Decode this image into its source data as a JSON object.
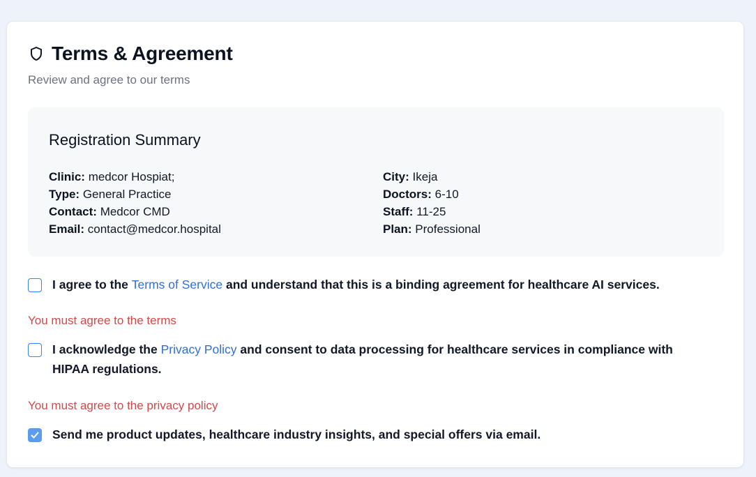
{
  "header": {
    "title": "Terms & Agreement",
    "subtitle": "Review and agree to our terms",
    "icon": "shield-icon"
  },
  "summary": {
    "title": "Registration Summary",
    "left": [
      {
        "label": "Clinic:",
        "value": "medcor Hospiat;"
      },
      {
        "label": "Type:",
        "value": "General Practice"
      },
      {
        "label": "Contact:",
        "value": "Medcor CMD"
      },
      {
        "label": "Email:",
        "value": "contact@medcor.hospital"
      }
    ],
    "right": [
      {
        "label": "City:",
        "value": "Ikeja"
      },
      {
        "label": "Doctors:",
        "value": "6-10"
      },
      {
        "label": "Staff:",
        "value": "11-25"
      },
      {
        "label": "Plan:",
        "value": "Professional"
      }
    ]
  },
  "terms": {
    "checked": false,
    "prefix": "I agree to the ",
    "link": "Terms of Service",
    "suffix": " and understand that this is a binding agreement for healthcare AI services.",
    "error": "You must agree to the terms"
  },
  "privacy": {
    "checked": false,
    "prefix": "I acknowledge the ",
    "link": "Privacy Policy",
    "suffix": " and consent to data processing for healthcare services in compliance with HIPAA regulations.",
    "error": "You must agree to the privacy policy"
  },
  "marketing": {
    "checked": true,
    "text": "Send me product updates, healthcare industry insights, and special offers via email."
  },
  "colors": {
    "accent": "#3b82f6",
    "link": "#2f6fd8",
    "error": "#d54848",
    "summary_bg": "#f7f8fa"
  }
}
